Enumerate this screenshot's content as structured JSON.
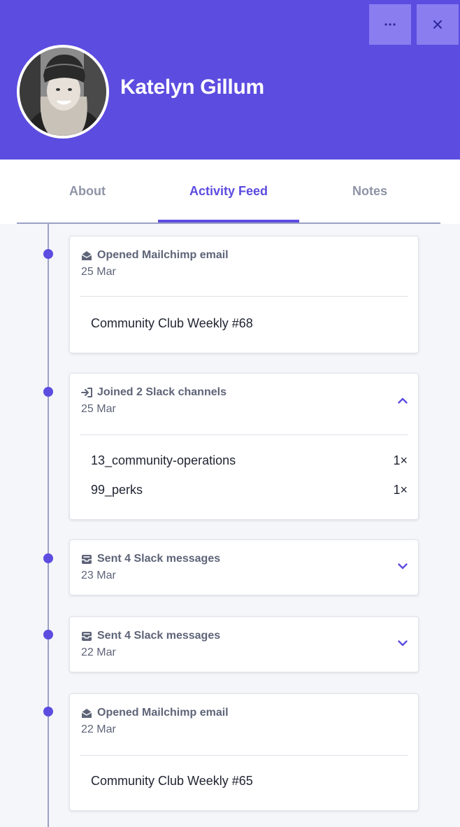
{
  "header": {
    "name": "Katelyn Gillum",
    "more_icon": "ellipsis-icon",
    "close_icon": "close-icon",
    "more_label": "···",
    "close_label": "✕",
    "accent": "#5c4ce0"
  },
  "tabs": [
    {
      "label": "About"
    },
    {
      "label": "Activity Feed",
      "active": true
    },
    {
      "label": "Notes"
    }
  ],
  "feed": [
    {
      "icon": "envelope-open-icon",
      "title": "Opened Mailchimp email",
      "date": "25 Mar",
      "body": "Community Club Weekly #68"
    },
    {
      "icon": "sign-in-icon",
      "title": "Joined 2 Slack channels",
      "date": "25 Mar",
      "expanded": true,
      "rows": [
        {
          "name": "13_community-operations",
          "count": "1×"
        },
        {
          "name": "99_perks",
          "count": "1×"
        }
      ]
    },
    {
      "icon": "inbox-icon",
      "title": "Sent 4 Slack messages",
      "date": "23 Mar",
      "expanded": false
    },
    {
      "icon": "inbox-icon",
      "title": "Sent 4 Slack messages",
      "date": "22 Mar",
      "expanded": false
    },
    {
      "icon": "envelope-open-icon",
      "title": "Opened Mailchimp email",
      "date": "22 Mar",
      "body": "Community Club Weekly #65"
    }
  ]
}
